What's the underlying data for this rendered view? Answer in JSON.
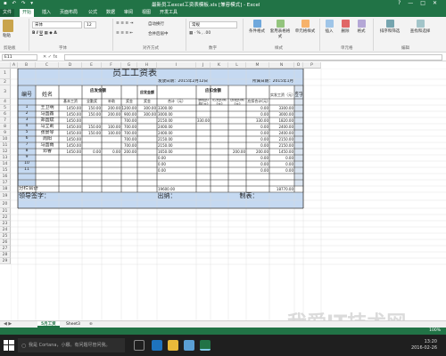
{
  "window": {
    "title": "最新员工excel工资表模板.xls  [兼容模式] - Excel",
    "controls": [
      "?",
      "—",
      "□",
      "✕"
    ]
  },
  "ribbon_tabs": [
    "文件",
    "开始",
    "插入",
    "页面布局",
    "公式",
    "数据",
    "审阅",
    "视图",
    "开发工具"
  ],
  "ribbon": {
    "font_name": "宋体",
    "font_size": "12",
    "number_format": "常规",
    "groups": [
      "剪贴板",
      "字体",
      "对齐方式",
      "数字",
      "样式",
      "单元格",
      "编辑"
    ],
    "buttons": [
      "粘贴",
      "自动换行",
      "合并后居中",
      "条件格式",
      "套用表格格式",
      "单元格样式",
      "插入",
      "删除",
      "格式",
      "排序和筛选",
      "查找和选择"
    ]
  },
  "formula_bar": {
    "name_box": "E11",
    "formula": ""
  },
  "columns": [
    "A",
    "B",
    "C",
    "D",
    "E",
    "F",
    "G",
    "H",
    "I",
    "J",
    "K",
    "L",
    "M",
    "N",
    "O",
    "P"
  ],
  "rows": [
    "1",
    "2",
    "3",
    "4",
    "5",
    "6",
    "7",
    "8",
    "9",
    "10",
    "11",
    "12",
    "13",
    "14",
    "15",
    "16",
    "17",
    "18",
    "19",
    "20",
    "21",
    "22",
    "23",
    "24",
    "25",
    "26",
    "27",
    "28",
    "29"
  ],
  "sheet": {
    "title": "员工工资表",
    "issue_date": "发放日期：2015年2月12日",
    "period": "所属日期：2015年1月",
    "hdr_no": "编号",
    "hdr_name": "姓名",
    "hdr_should": "应发金额",
    "hdr_should_sub": "应发金额",
    "hdr_deduct": "应扣金额",
    "hdr_actual": "实发工资（元）",
    "hdr_sign": "签字",
    "sub_cols": [
      "基本工资",
      "全勤奖",
      "补助",
      "奖金",
      "奖金",
      "合计（元）",
      "请假扣款(元)",
      "迟到扣款(元)",
      "违规扣款(元)",
      "应扣合计(元)"
    ],
    "employees": [
      {
        "no": "1",
        "name": "王卫明",
        "v": [
          "1450.00",
          "150.00",
          "200.00",
          "1200.00",
          "300.00",
          "3300.00",
          "",
          "",
          "",
          "0.00",
          "3300.00"
        ]
      },
      {
        "no": "2",
        "name": "马国鑫",
        "v": [
          "1450.00",
          "150.00",
          "200.00",
          "900.00",
          "300.00",
          "3000.00",
          "",
          "",
          "",
          "0.00",
          "3000.00"
        ]
      },
      {
        "no": "3",
        "name": "郑国斌",
        "v": [
          "1450.00",
          "",
          "",
          "700.00",
          "",
          "2150.00",
          "330.00",
          "",
          "",
          "330.00",
          "1820.00"
        ]
      },
      {
        "no": "4",
        "name": "马立莉",
        "v": [
          "1450.00",
          "150.00",
          "100.00",
          "700.00",
          "",
          "2400.00",
          "",
          "",
          "",
          "0.00",
          "2400.00"
        ]
      },
      {
        "no": "5",
        "name": "张景琴",
        "v": [
          "1450.00",
          "150.00",
          "100.00",
          "700.00",
          "",
          "2400.00",
          "",
          "",
          "",
          "0.00",
          "2400.00"
        ]
      },
      {
        "no": "6",
        "name": "周阳",
        "v": [
          "1450.00",
          "",
          "",
          "700.00",
          "",
          "2150.00",
          "",
          "",
          "",
          "0.00",
          "2150.00"
        ]
      },
      {
        "no": "7",
        "name": "马国雨",
        "v": [
          "1450.00",
          "",
          "",
          "700.00",
          "",
          "2150.00",
          "",
          "",
          "",
          "0.00",
          "2150.00"
        ]
      },
      {
        "no": "8",
        "name": "邓睿",
        "v": [
          "1450.00",
          "0.00",
          "0.00",
          "200.00",
          "",
          "1650.00",
          "",
          "",
          "200.00",
          "200.00",
          "1450.00"
        ]
      },
      {
        "no": "9",
        "name": "",
        "v": [
          "",
          "",
          "",
          "",
          "",
          "0.00",
          "",
          "",
          "",
          "0.00",
          "0.00"
        ]
      },
      {
        "no": "10",
        "name": "",
        "v": [
          "",
          "",
          "",
          "",
          "",
          "0.00",
          "",
          "",
          "",
          "0.00",
          "0.00"
        ]
      },
      {
        "no": "11",
        "name": "",
        "v": [
          "",
          "",
          "",
          "",
          "",
          "0.00",
          "",
          "",
          "",
          "0.00",
          "0.00"
        ]
      }
    ],
    "subtotal_label": "分栏合计",
    "subtotal_total": "19600.00",
    "subtotal_actual": "18770.00",
    "sig_leader": "领导签字：",
    "sig_cashier": "出纳：",
    "sig_maker": "制表："
  },
  "sheet_tabs": [
    "5月工资",
    "Sheet3"
  ],
  "zoom": "100%",
  "taskbar": {
    "search": "我是 Cortana，小娜。有问题尽管问我。",
    "time": "13:20",
    "date": "2016-02-26"
  },
  "watermark": {
    "text": "我爱IT技术网",
    "url": "jingyan.baidu.com"
  },
  "colors": {
    "excel_green": "#217346",
    "title_blue": "#c5d9f1",
    "grid": "#d9d9d9"
  }
}
